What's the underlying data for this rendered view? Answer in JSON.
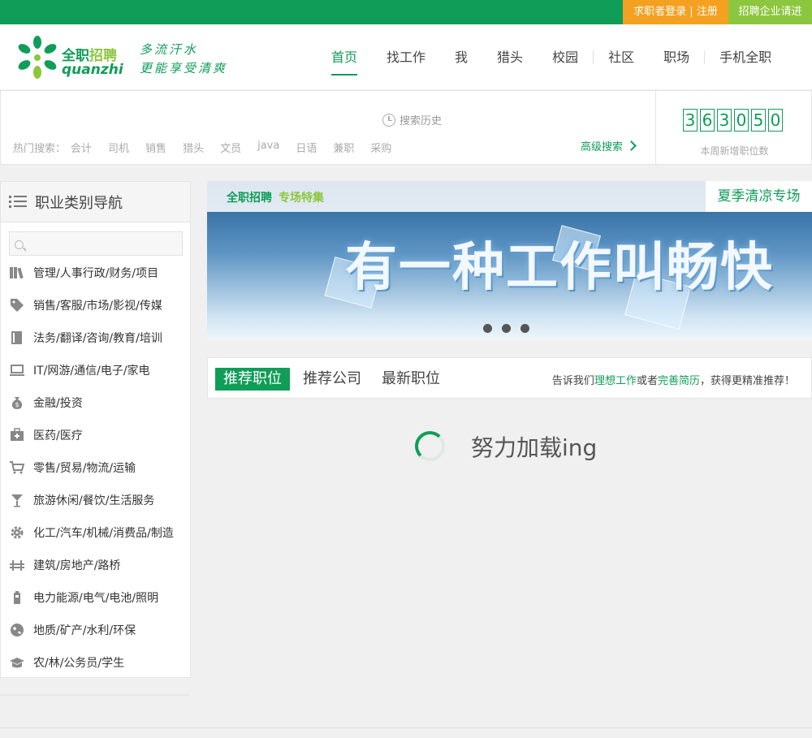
{
  "topbar": {
    "login": "求职者登录",
    "separator": "|",
    "register": "注册",
    "employer": "招聘企业请进"
  },
  "header": {
    "logo_cn_prefix": "全职",
    "logo_cn_suffix": "招聘",
    "logo_en": "quanzhi",
    "slogan_line1": "多流汗水",
    "slogan_line2": "更能享受清爽",
    "nav": [
      "首页",
      "找工作",
      "我",
      "猎头",
      "校园",
      "社区",
      "职场",
      "手机全职"
    ]
  },
  "search": {
    "history": "搜索历史",
    "hot_label": "热门搜索：",
    "hot_keywords": [
      "会计",
      "司机",
      "销售",
      "猎头",
      "文员",
      "java",
      "日语",
      "兼职",
      "采购"
    ],
    "advanced": "高级搜索"
  },
  "counter": {
    "digits": [
      "3",
      "6",
      "3",
      "0",
      "5",
      "0"
    ],
    "label": "本周新增职位数"
  },
  "sidebar": {
    "title": "职业类别导航",
    "items": [
      {
        "label": "管理/人事行政/财务/项目",
        "icon": "books-icon"
      },
      {
        "label": "销售/客服/市场/影视/传媒",
        "icon": "tag-icon"
      },
      {
        "label": "法务/翻译/咨询/教育/培训",
        "icon": "book-icon"
      },
      {
        "label": "IT/网游/通信/电子/家电",
        "icon": "computer-icon"
      },
      {
        "label": "金融/投资",
        "icon": "money-bag-icon"
      },
      {
        "label": "医药/医疗",
        "icon": "medkit-icon"
      },
      {
        "label": "零售/贸易/物流/运输",
        "icon": "cart-icon"
      },
      {
        "label": "旅游休闲/餐饮/生活服务",
        "icon": "cocktail-icon"
      },
      {
        "label": "化工/汽车/机械/消费品/制造",
        "icon": "gear-icon"
      },
      {
        "label": "建筑/房地产/路桥",
        "icon": "bridge-icon"
      },
      {
        "label": "电力能源/电气/电池/照明",
        "icon": "battery-icon"
      },
      {
        "label": "地质/矿产/水利/环保",
        "icon": "globe-icon"
      },
      {
        "label": "农/林/公务员/学生",
        "icon": "graduation-cap-icon"
      }
    ]
  },
  "banner": {
    "logo": "全职招聘",
    "logo_tag": "专场特集",
    "right_label": "夏季清凉专场",
    "headline": "有一种工作叫畅快"
  },
  "tabs": {
    "items": [
      "推荐职位",
      "推荐公司",
      "最新职位"
    ],
    "tip_prefix": "告诉我们",
    "tip_link1": "理想工作",
    "tip_mid": "或者",
    "tip_link2": "完善简历",
    "tip_suffix": "，获得更精准推荐！"
  },
  "loading": {
    "text": "努力加载ing"
  },
  "colors": {
    "primary": "#0f9d58",
    "accent_orange": "#f4a020",
    "accent_lime": "#8cc63e"
  }
}
